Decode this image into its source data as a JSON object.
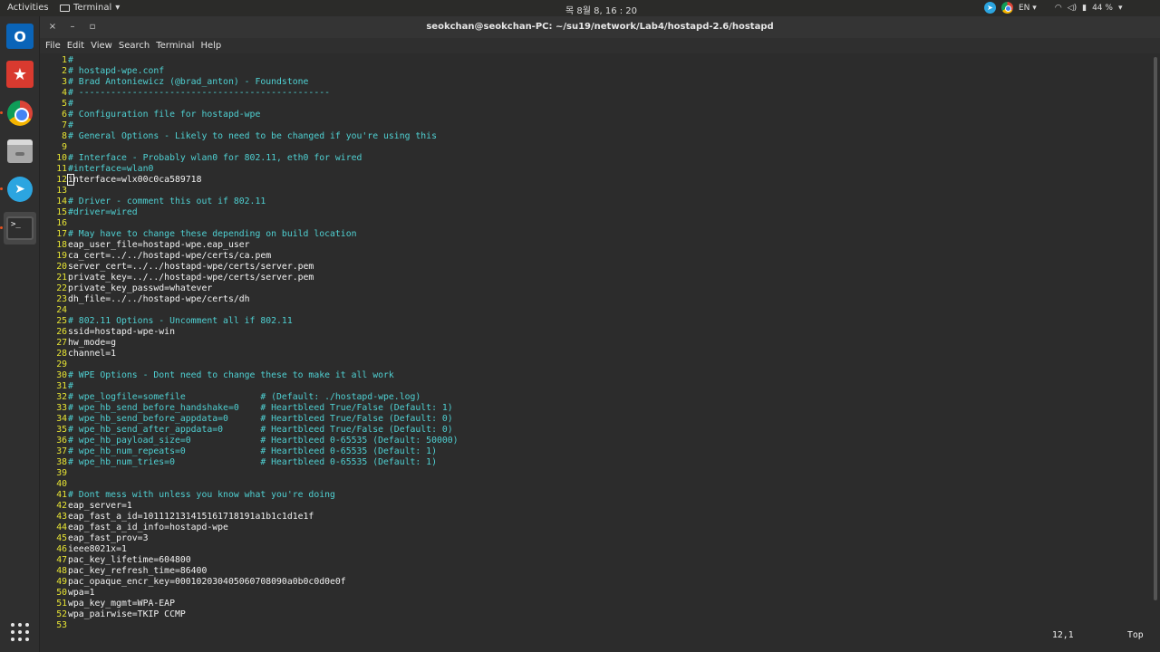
{
  "top_panel": {
    "activities": "Activities",
    "app_name": "Terminal",
    "app_arrow": "▾",
    "clock": "목 8월 8, 16 : 20",
    "language": "EN",
    "battery": "44 %"
  },
  "dock": {
    "items": [
      {
        "name": "outlook-icon",
        "glyph": "O"
      },
      {
        "name": "wunderlist-icon",
        "glyph": "★"
      },
      {
        "name": "chrome-icon"
      },
      {
        "name": "files-icon"
      },
      {
        "name": "telegram-icon",
        "glyph": "➤"
      },
      {
        "name": "terminal-icon",
        "glyph": ">_"
      },
      {
        "name": "show-apps-icon"
      }
    ]
  },
  "window": {
    "title": "seokchan@seokchan-PC: ~/su19/network/Lab4/hostapd-2.6/hostapd",
    "close_glyph": "×",
    "minimize_glyph": "–",
    "maximize_glyph": "▫"
  },
  "menubar": [
    "File",
    "Edit",
    "View",
    "Search",
    "Terminal",
    "Help"
  ],
  "editor": {
    "lines": [
      {
        "n": "1",
        "text": "#",
        "type": "comment"
      },
      {
        "n": "2",
        "text": "# hostapd-wpe.conf",
        "type": "comment"
      },
      {
        "n": "3",
        "text": "# Brad Antoniewicz (@brad_anton) - Foundstone",
        "type": "comment"
      },
      {
        "n": "4",
        "text": "# -----------------------------------------------",
        "type": "comment"
      },
      {
        "n": "5",
        "text": "#",
        "type": "comment"
      },
      {
        "n": "6",
        "text": "# Configuration file for hostapd-wpe",
        "type": "comment"
      },
      {
        "n": "7",
        "text": "#",
        "type": "comment"
      },
      {
        "n": "8",
        "text": "# General Options - Likely to need to be changed if you're using this",
        "type": "comment"
      },
      {
        "n": "9",
        "text": "",
        "type": "plain"
      },
      {
        "n": "10",
        "text": "# Interface - Probably wlan0 for 802.11, eth0 for wired",
        "type": "comment"
      },
      {
        "n": "11",
        "text": "#interface=wlan0",
        "type": "comment"
      },
      {
        "n": "12",
        "text": "interface=wlx00c0ca589718",
        "type": "plain"
      },
      {
        "n": "13",
        "text": "",
        "type": "plain"
      },
      {
        "n": "14",
        "text": "# Driver - comment this out if 802.11",
        "type": "comment"
      },
      {
        "n": "15",
        "text": "#driver=wired",
        "type": "comment"
      },
      {
        "n": "16",
        "text": "",
        "type": "plain"
      },
      {
        "n": "17",
        "text": "# May have to change these depending on build location",
        "type": "comment"
      },
      {
        "n": "18",
        "text": "eap_user_file=hostapd-wpe.eap_user",
        "type": "plain"
      },
      {
        "n": "19",
        "text": "ca_cert=../../hostapd-wpe/certs/ca.pem",
        "type": "plain"
      },
      {
        "n": "20",
        "text": "server_cert=../../hostapd-wpe/certs/server.pem",
        "type": "plain"
      },
      {
        "n": "21",
        "text": "private_key=../../hostapd-wpe/certs/server.pem",
        "type": "plain"
      },
      {
        "n": "22",
        "text": "private_key_passwd=whatever",
        "type": "plain"
      },
      {
        "n": "23",
        "text": "dh_file=../../hostapd-wpe/certs/dh",
        "type": "plain"
      },
      {
        "n": "24",
        "text": "",
        "type": "plain"
      },
      {
        "n": "25",
        "text": "# 802.11 Options - Uncomment all if 802.11",
        "type": "comment"
      },
      {
        "n": "26",
        "text": "ssid=hostapd-wpe-win",
        "type": "plain"
      },
      {
        "n": "27",
        "text": "hw_mode=g",
        "type": "plain"
      },
      {
        "n": "28",
        "text": "channel=1",
        "type": "plain"
      },
      {
        "n": "29",
        "text": "",
        "type": "plain"
      },
      {
        "n": "30",
        "text": "# WPE Options - Dont need to change these to make it all work",
        "type": "comment"
      },
      {
        "n": "31",
        "text": "#",
        "type": "comment"
      },
      {
        "n": "32",
        "text": "# wpe_logfile=somefile              # (Default: ./hostapd-wpe.log)",
        "type": "comment"
      },
      {
        "n": "33",
        "text": "# wpe_hb_send_before_handshake=0    # Heartbleed True/False (Default: 1)",
        "type": "comment"
      },
      {
        "n": "34",
        "text": "# wpe_hb_send_before_appdata=0      # Heartbleed True/False (Default: 0)",
        "type": "comment"
      },
      {
        "n": "35",
        "text": "# wpe_hb_send_after_appdata=0       # Heartbleed True/False (Default: 0)",
        "type": "comment"
      },
      {
        "n": "36",
        "text": "# wpe_hb_payload_size=0             # Heartbleed 0-65535 (Default: 50000)",
        "type": "comment"
      },
      {
        "n": "37",
        "text": "# wpe_hb_num_repeats=0              # Heartbleed 0-65535 (Default: 1)",
        "type": "comment"
      },
      {
        "n": "38",
        "text": "# wpe_hb_num_tries=0                # Heartbleed 0-65535 (Default: 1)",
        "type": "comment"
      },
      {
        "n": "39",
        "text": "",
        "type": "plain"
      },
      {
        "n": "40",
        "text": "",
        "type": "plain"
      },
      {
        "n": "41",
        "text": "# Dont mess with unless you know what you're doing",
        "type": "comment"
      },
      {
        "n": "42",
        "text": "eap_server=1",
        "type": "plain"
      },
      {
        "n": "43",
        "text": "eap_fast_a_id=101112131415161718191a1b1c1d1e1f",
        "type": "plain"
      },
      {
        "n": "44",
        "text": "eap_fast_a_id_info=hostapd-wpe",
        "type": "plain"
      },
      {
        "n": "45",
        "text": "eap_fast_prov=3",
        "type": "plain"
      },
      {
        "n": "46",
        "text": "ieee8021x=1",
        "type": "plain"
      },
      {
        "n": "47",
        "text": "pac_key_lifetime=604800",
        "type": "plain"
      },
      {
        "n": "48",
        "text": "pac_key_refresh_time=86400",
        "type": "plain"
      },
      {
        "n": "49",
        "text": "pac_opaque_encr_key=000102030405060708090a0b0c0d0e0f",
        "type": "plain"
      },
      {
        "n": "50",
        "text": "wpa=1",
        "type": "plain"
      },
      {
        "n": "51",
        "text": "wpa_key_mgmt=WPA-EAP",
        "type": "plain"
      },
      {
        "n": "52",
        "text": "wpa_pairwise=TKIP CCMP",
        "type": "plain"
      },
      {
        "n": "53",
        "text": "",
        "type": "plain"
      }
    ],
    "cursor_line": "12",
    "status_position": "12,1",
    "status_scroll": "Top"
  },
  "colors": {
    "line_number": "#e8e534",
    "comment": "#4fd0d2",
    "text": "#f2f2f2",
    "background": "#2c2c2c"
  }
}
